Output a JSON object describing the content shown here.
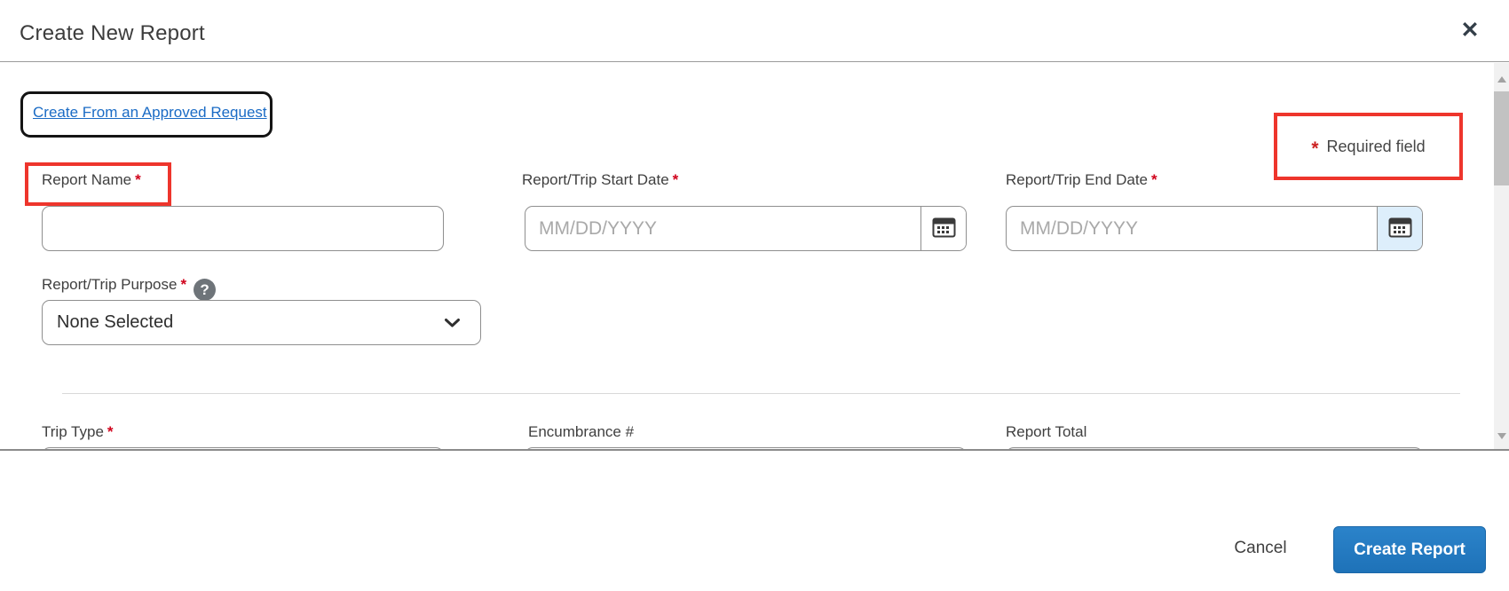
{
  "modal": {
    "title": "Create New Report",
    "close_glyph": "✕"
  },
  "approved_request_link": {
    "label": "Create From an Approved Request"
  },
  "legend": {
    "asterisk": "*",
    "required_label": "Required field"
  },
  "fields": {
    "report_name": {
      "label": "Report Name",
      "required": "*",
      "value": ""
    },
    "start_date": {
      "label": "Report/Trip Start Date",
      "required": "*",
      "placeholder": "MM/DD/YYYY",
      "value": ""
    },
    "end_date": {
      "label": "Report/Trip End Date",
      "required": "*",
      "placeholder": "MM/DD/YYYY",
      "value": ""
    },
    "purpose": {
      "label": "Report/Trip Purpose",
      "required": "*",
      "help_glyph": "?",
      "selected": "None Selected"
    },
    "trip_type": {
      "label": "Trip Type",
      "required": "*"
    },
    "encumbrance": {
      "label": "Encumbrance #"
    },
    "report_total": {
      "label": "Report Total"
    }
  },
  "footer": {
    "cancel_label": "Cancel",
    "create_label": "Create Report"
  },
  "colors": {
    "primary_button_blue": "#2279c2",
    "link_blue": "#1a6bc5",
    "annotation_red": "#ee352c",
    "calendar_highlight": "#ddeefb",
    "label_gray": "#3f3f3f"
  }
}
